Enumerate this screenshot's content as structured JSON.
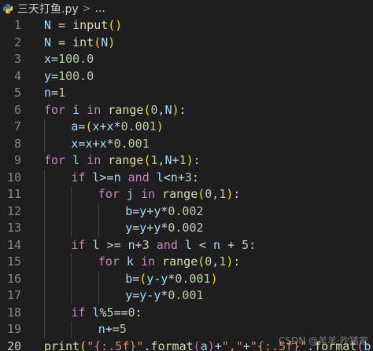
{
  "breadcrumb": {
    "file_name": "三天打鱼.py",
    "separator": ">",
    "more": "..."
  },
  "colors": {
    "background": "#1e1e1e",
    "keyword": "#c586c0",
    "builtin": "#dcdcaa",
    "variable": "#9cdcfe",
    "number": "#b5cea8",
    "string": "#ce9178",
    "text": "#d4d4d4",
    "bracket1": "#ffd700",
    "bracket2": "#da70d6",
    "bracket3": "#179fff",
    "line_number": "#858585"
  },
  "code_lines": [
    {
      "n": "1",
      "indent": 0,
      "tokens": [
        [
          "N",
          "v"
        ],
        [
          " = ",
          "p"
        ],
        [
          "input",
          "f"
        ],
        [
          "()",
          "b1"
        ]
      ]
    },
    {
      "n": "2",
      "indent": 0,
      "tokens": [
        [
          "N",
          "v"
        ],
        [
          " = ",
          "p"
        ],
        [
          "int",
          "f"
        ],
        [
          "(",
          "b1"
        ],
        [
          "N",
          "v"
        ],
        [
          ")",
          "b1"
        ]
      ]
    },
    {
      "n": "3",
      "indent": 0,
      "tokens": [
        [
          "x",
          "v"
        ],
        [
          "=",
          "p"
        ],
        [
          "100.0",
          "n"
        ]
      ]
    },
    {
      "n": "4",
      "indent": 0,
      "tokens": [
        [
          "y",
          "v"
        ],
        [
          "=",
          "p"
        ],
        [
          "100.0",
          "n"
        ]
      ]
    },
    {
      "n": "5",
      "indent": 0,
      "tokens": [
        [
          "n",
          "v"
        ],
        [
          "=",
          "p"
        ],
        [
          "1",
          "n"
        ]
      ]
    },
    {
      "n": "6",
      "indent": 0,
      "tokens": [
        [
          "for",
          "k"
        ],
        [
          " ",
          "p"
        ],
        [
          "i",
          "v"
        ],
        [
          " ",
          "p"
        ],
        [
          "in",
          "k"
        ],
        [
          " ",
          "p"
        ],
        [
          "range",
          "f"
        ],
        [
          "(",
          "b1"
        ],
        [
          "0",
          "n"
        ],
        [
          ",",
          "p"
        ],
        [
          "N",
          "v"
        ],
        [
          ")",
          "b1"
        ],
        [
          ":",
          "p"
        ]
      ]
    },
    {
      "n": "7",
      "indent": 1,
      "tokens": [
        [
          "a",
          "v"
        ],
        [
          "=",
          "p"
        ],
        [
          "(",
          "b1"
        ],
        [
          "x",
          "v"
        ],
        [
          "+",
          "p"
        ],
        [
          "x",
          "v"
        ],
        [
          "*",
          "p"
        ],
        [
          "0.001",
          "n"
        ],
        [
          ")",
          "b1"
        ]
      ]
    },
    {
      "n": "8",
      "indent": 1,
      "tokens": [
        [
          "x",
          "v"
        ],
        [
          "=",
          "p"
        ],
        [
          "x",
          "v"
        ],
        [
          "+",
          "p"
        ],
        [
          "x",
          "v"
        ],
        [
          "*",
          "p"
        ],
        [
          "0.001",
          "n"
        ]
      ]
    },
    {
      "n": "9",
      "indent": 0,
      "tokens": [
        [
          "for",
          "k"
        ],
        [
          " ",
          "p"
        ],
        [
          "l",
          "v"
        ],
        [
          " ",
          "p"
        ],
        [
          "in",
          "k"
        ],
        [
          " ",
          "p"
        ],
        [
          "range",
          "f"
        ],
        [
          "(",
          "b1"
        ],
        [
          "1",
          "n"
        ],
        [
          ",",
          "p"
        ],
        [
          "N",
          "v"
        ],
        [
          "+",
          "p"
        ],
        [
          "1",
          "n"
        ],
        [
          ")",
          "b1"
        ],
        [
          ":",
          "p"
        ]
      ]
    },
    {
      "n": "10",
      "indent": 1,
      "tokens": [
        [
          "if",
          "k"
        ],
        [
          " ",
          "p"
        ],
        [
          "l",
          "v"
        ],
        [
          ">=",
          "p"
        ],
        [
          "n",
          "v"
        ],
        [
          " ",
          "p"
        ],
        [
          "and",
          "k"
        ],
        [
          " ",
          "p"
        ],
        [
          "l",
          "v"
        ],
        [
          "<",
          "p"
        ],
        [
          "n",
          "v"
        ],
        [
          "+",
          "p"
        ],
        [
          "3",
          "n"
        ],
        [
          ":",
          "p"
        ]
      ]
    },
    {
      "n": "11",
      "indent": 2,
      "tokens": [
        [
          "for",
          "k"
        ],
        [
          " ",
          "p"
        ],
        [
          "j",
          "v"
        ],
        [
          " ",
          "p"
        ],
        [
          "in",
          "k"
        ],
        [
          " ",
          "p"
        ],
        [
          "range",
          "f"
        ],
        [
          "(",
          "b1"
        ],
        [
          "0",
          "n"
        ],
        [
          ",",
          "p"
        ],
        [
          "1",
          "n"
        ],
        [
          ")",
          "b1"
        ],
        [
          ":",
          "p"
        ]
      ]
    },
    {
      "n": "12",
      "indent": 3,
      "tokens": [
        [
          "b",
          "v"
        ],
        [
          "=",
          "p"
        ],
        [
          "y",
          "v"
        ],
        [
          "+",
          "p"
        ],
        [
          "y",
          "v"
        ],
        [
          "*",
          "p"
        ],
        [
          "0.002",
          "n"
        ]
      ]
    },
    {
      "n": "13",
      "indent": 3,
      "tokens": [
        [
          "y",
          "v"
        ],
        [
          "=",
          "p"
        ],
        [
          "y",
          "v"
        ],
        [
          "+",
          "p"
        ],
        [
          "y",
          "v"
        ],
        [
          "*",
          "p"
        ],
        [
          "0.002",
          "n"
        ]
      ]
    },
    {
      "n": "14",
      "indent": 1,
      "tokens": [
        [
          "if",
          "k"
        ],
        [
          " ",
          "p"
        ],
        [
          "l",
          "v"
        ],
        [
          " >= ",
          "p"
        ],
        [
          "n",
          "v"
        ],
        [
          "+",
          "p"
        ],
        [
          "3",
          "n"
        ],
        [
          " ",
          "p"
        ],
        [
          "and",
          "k"
        ],
        [
          " ",
          "p"
        ],
        [
          "l",
          "v"
        ],
        [
          " < ",
          "p"
        ],
        [
          "n",
          "v"
        ],
        [
          " + ",
          "p"
        ],
        [
          "5",
          "n"
        ],
        [
          ":",
          "p"
        ]
      ]
    },
    {
      "n": "15",
      "indent": 2,
      "tokens": [
        [
          "for",
          "k"
        ],
        [
          " ",
          "p"
        ],
        [
          "k",
          "v"
        ],
        [
          " ",
          "p"
        ],
        [
          "in",
          "k"
        ],
        [
          " ",
          "p"
        ],
        [
          "range",
          "f"
        ],
        [
          "(",
          "b1"
        ],
        [
          "0",
          "n"
        ],
        [
          ",",
          "p"
        ],
        [
          "1",
          "n"
        ],
        [
          ")",
          "b1"
        ],
        [
          ":",
          "p"
        ]
      ]
    },
    {
      "n": "16",
      "indent": 3,
      "tokens": [
        [
          "b",
          "v"
        ],
        [
          "=",
          "p"
        ],
        [
          "(",
          "b1"
        ],
        [
          "y",
          "v"
        ],
        [
          "-",
          "p"
        ],
        [
          "y",
          "v"
        ],
        [
          "*",
          "p"
        ],
        [
          "0.001",
          "n"
        ],
        [
          ")",
          "b1"
        ]
      ]
    },
    {
      "n": "17",
      "indent": 3,
      "tokens": [
        [
          "y",
          "v"
        ],
        [
          "=",
          "p"
        ],
        [
          "y",
          "v"
        ],
        [
          "-",
          "p"
        ],
        [
          "y",
          "v"
        ],
        [
          "*",
          "p"
        ],
        [
          "0.001",
          "n"
        ]
      ]
    },
    {
      "n": "18",
      "indent": 1,
      "tokens": [
        [
          "if",
          "k"
        ],
        [
          " ",
          "p"
        ],
        [
          "l",
          "v"
        ],
        [
          "%",
          "p"
        ],
        [
          "5",
          "n"
        ],
        [
          "==",
          "p"
        ],
        [
          "0",
          "n"
        ],
        [
          ":",
          "p"
        ]
      ]
    },
    {
      "n": "19",
      "indent": 2,
      "tokens": [
        [
          "n",
          "v"
        ],
        [
          "+=",
          "p"
        ],
        [
          "5",
          "n"
        ]
      ]
    },
    {
      "n": "20",
      "indent": 0,
      "tokens": [
        [
          "print",
          "f"
        ],
        [
          "(",
          "b1"
        ],
        [
          "\"{:.5f}\"",
          "s"
        ],
        [
          ".",
          "p"
        ],
        [
          "format",
          "f"
        ],
        [
          "(",
          "b2"
        ],
        [
          "a",
          "v"
        ],
        [
          ")",
          "b2"
        ],
        [
          "+",
          "p"
        ],
        [
          "\",\"",
          "s"
        ],
        [
          "+",
          "p"
        ],
        [
          "\"{:.5f}\"",
          "s"
        ],
        [
          ".",
          "p"
        ],
        [
          "format",
          "f"
        ],
        [
          "(",
          "b2"
        ],
        [
          "b",
          "v"
        ],
        [
          ")",
          "b2"
        ],
        [
          ")",
          "b1"
        ]
      ]
    }
  ],
  "active_line": "20",
  "watermark": "CSDN @羊羊·吹猪家"
}
